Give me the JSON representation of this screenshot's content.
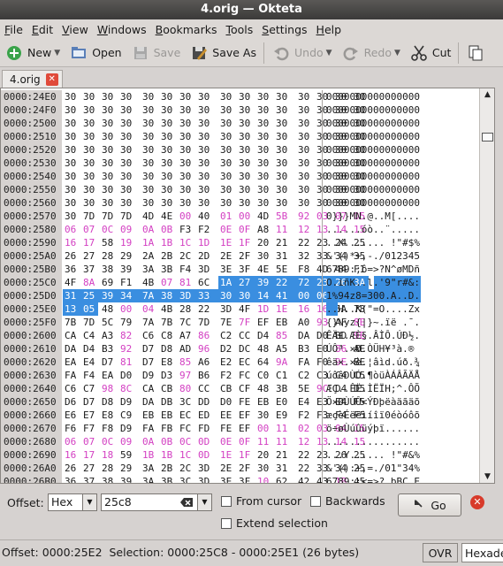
{
  "window": {
    "title": "4.orig — Okteta"
  },
  "menu": [
    {
      "label": "File",
      "key": "F",
      "rest": "ile"
    },
    {
      "label": "Edit",
      "key": "E",
      "rest": "dit"
    },
    {
      "label": "View",
      "key": "V",
      "rest": "iew"
    },
    {
      "label": "Windows",
      "key": "W",
      "rest": "indows"
    },
    {
      "label": "Bookmarks",
      "key": "B",
      "rest": "ookmarks"
    },
    {
      "label": "Tools",
      "key": "T",
      "rest": "ools"
    },
    {
      "label": "Settings",
      "key": "S",
      "rest": "ettings"
    },
    {
      "label": "Help",
      "key": "H",
      "rest": "elp"
    }
  ],
  "toolbar": {
    "new": "New",
    "open": "Open",
    "save": "Save",
    "save_as": "Save As",
    "undo": "Undo",
    "redo": "Redo",
    "cut": "Cut"
  },
  "tab": {
    "label": "4.orig"
  },
  "rows": [
    {
      "off": "0000:24E0",
      "hex": "30 30 30 30  30 30 30 30  30 30 30 30  30 30 30 30",
      "chars": "0000000000000000",
      "pink": [],
      "sel": []
    },
    {
      "off": "0000:24F0",
      "hex": "30 30 30 30  30 30 30 30  30 30 30 30  30 30 30 30",
      "chars": "0000000000000000",
      "pink": [],
      "sel": []
    },
    {
      "off": "0000:2500",
      "hex": "30 30 30 30  30 30 30 30  30 30 30 30  30 30 30 30",
      "chars": "0000000000000000",
      "pink": [],
      "sel": []
    },
    {
      "off": "0000:2510",
      "hex": "30 30 30 30  30 30 30 30  30 30 30 30  30 30 30 30",
      "chars": "0000000000000000",
      "pink": [],
      "sel": []
    },
    {
      "off": "0000:2520",
      "hex": "30 30 30 30  30 30 30 30  30 30 30 30  30 30 30 30",
      "chars": "0000000000000000",
      "pink": [],
      "sel": []
    },
    {
      "off": "0000:2530",
      "hex": "30 30 30 30  30 30 30 30  30 30 30 30  30 30 30 30",
      "chars": "0000000000000000",
      "pink": [],
      "sel": []
    },
    {
      "off": "0000:2540",
      "hex": "30 30 30 30  30 30 30 30  30 30 30 30  30 30 30 30",
      "chars": "0000000000000000",
      "pink": [],
      "sel": []
    },
    {
      "off": "0000:2550",
      "hex": "30 30 30 30  30 30 30 30  30 30 30 30  30 30 30 30",
      "chars": "0000000000000000",
      "pink": [],
      "sel": []
    },
    {
      "off": "0000:2560",
      "hex": "30 30 30 30  30 30 30 30  30 30 30 30  30 30 30 30",
      "chars": "0000000000000000",
      "pink": [],
      "sel": []
    },
    {
      "off": "0000:2570",
      "hex": "30 7D 7D 7D  4D 4E 00 40  01 00 4D 5B  92 03 07 05",
      "chars": "0}}}MN.@..M[....",
      "pink": [
        6,
        8,
        9,
        11,
        12,
        13,
        14,
        15
      ],
      "sel": []
    },
    {
      "off": "0000:2580",
      "hex": "06 07 0C 09  0A 0B F3 F2  0E 0F A8 11  12 13 14 15",
      "chars": "......óò..¨.....",
      "pink": [
        0,
        1,
        2,
        3,
        4,
        5,
        8,
        9,
        11,
        12,
        13,
        14,
        15
      ],
      "sel": []
    },
    {
      "off": "0000:2590",
      "hex": "16 17 58 19  1A 1B 1C 1D  1E 1F 20 21  22 23 24 25",
      "chars": "..X....... !\"#$%",
      "pink": [
        0,
        1,
        3,
        4,
        5,
        6,
        7,
        8,
        9
      ],
      "sel": []
    },
    {
      "off": "0000:25A0",
      "hex": "26 27 28 29  2A 2B 2C 2D  2E 2F 30 31  32 33 34 35",
      "chars": "&'()*+,-./012345",
      "pink": [],
      "sel": []
    },
    {
      "off": "0000:25B0",
      "hex": "36 37 38 39  3A 3B F4 3D  3E 3F 4E 5E  F8 4D 44 F1",
      "chars": "6789:;ô=>?N^øMDñ",
      "pink": [],
      "sel": []
    },
    {
      "off": "0000:25C0",
      "hex": "4F 8A 69 F1  4B 07 81 6C  1A 27 39 22  72 23 26 3A",
      "chars": "O.iñK..l.'9\"r#&:",
      "pink": [
        1,
        5,
        6,
        8
      ],
      "sel": [
        8,
        9,
        10,
        11,
        12,
        13,
        14,
        15
      ]
    },
    {
      "off": "0000:25D0",
      "hex": "31 25 39 34  7A 38 3D 33  30 30 14 41  00 06 44 17",
      "chars": "1%94z8=300.A..D.",
      "pink": [
        10,
        12,
        13,
        15
      ],
      "sel": [
        0,
        1,
        2,
        3,
        4,
        5,
        6,
        7,
        8,
        9,
        10,
        11,
        12,
        13,
        14,
        15
      ]
    },
    {
      "off": "0000:25E0",
      "hex": "13 05 48 00  04 4B 28 22  3D 4F 1D 1E  16 16 5A 78",
      "chars": "..H..K(\"=O....Zx",
      "pink": [
        0,
        1,
        3,
        4,
        10,
        11,
        12,
        13
      ],
      "sel": [
        0,
        1
      ]
    },
    {
      "off": "0000:25F0",
      "hex": "7B 7D 5C 79  7A 7B 7C 7D  7E 7F EF EB  A0 93 AF 8E",
      "chars": "{}\\yz{|}~.ïë .¯.",
      "pink": [
        9,
        13,
        15
      ],
      "sel": []
    },
    {
      "off": "0000:2600",
      "hex": "CA C4 A3 82  C6 C8 A7 86  C2 CC D4 85  DA D0 BD 9E",
      "chars": "ÊÄ£.ÆÈ§.ÂÌÔ.ÚÐ½.",
      "pink": [
        3,
        7,
        11,
        15
      ],
      "sel": []
    },
    {
      "off": "0000:2610",
      "hex": "DA D4 B3 92  D7 D8 AD 96  D2 DC 48 A5  B3 E0 86 AE",
      "chars": "ÚÔ³.×Ø.ÒÜH¥³à.®",
      "pink": [
        3,
        7,
        14
      ],
      "sel": []
    },
    {
      "off": "0000:2620",
      "hex": "EA E4 D7 81  D7 E8 85 A6  E2 EC 64 9A  FA F0 9E BE",
      "chars": "êä×.×è.¦âìd.úð.¾",
      "pink": [
        3,
        6,
        11,
        14
      ],
      "sel": []
    },
    {
      "off": "0000:2630",
      "hex": "FA F4 EA D0  D9 D3 97 B6  F2 FC C0 C1  C2 C3 C4 C5",
      "chars": "úôêÐÙÓ.¶òüÀÁÂÃÄÅ",
      "pink": [
        6
      ],
      "sel": []
    },
    {
      "off": "0000:2640",
      "hex": "C6 C7 98 8C  CA CB 80 CC  CB CF 48 3B  5E 9C D4 D5",
      "chars": "ÆÇ..ÊË.ÌËÏH;^.ÔÕ",
      "pink": [
        2,
        3,
        6,
        13
      ],
      "sel": []
    },
    {
      "off": "0000:2650",
      "hex": "D6 D7 D8 D9  DA DB 3C DD  D0 FE EB E0  E4 E3 E4 F5",
      "chars": "Ö×ØÙÚÛ<ÝÐþëàäãäõ",
      "pink": [],
      "sel": []
    },
    {
      "off": "0000:2660",
      "hex": "E6 E7 E8 C9  EB EB EC ED  EE EF 30 E9  F2 F3 F4 F5",
      "chars": "æçèÉëëìíîï0éòóôõ",
      "pink": [],
      "sel": []
    },
    {
      "off": "0000:2670",
      "hex": "F6 F7 F8 D9  FA FB FC FD  FE EF 00 11  02 03 04 15",
      "chars": "ö÷øÙúûüýþï......",
      "pink": [
        10,
        11,
        12,
        13,
        14,
        15
      ],
      "sel": []
    },
    {
      "off": "0000:2680",
      "hex": "06 07 0C 09  0A 0B 0C 0D  0E 0F 11 11  12 13 14 15",
      "chars": "................",
      "pink": [
        0,
        1,
        2,
        3,
        4,
        5,
        6,
        7,
        8,
        9,
        10,
        11,
        12,
        13,
        14,
        15
      ],
      "sel": []
    },
    {
      "off": "0000:2690",
      "hex": "16 17 18 59  1B 1B 1C 0D  1E 1F 20 21  22 23 26 25",
      "chars": "...Y...... !\"#&%",
      "pink": [
        0,
        1,
        2,
        4,
        5,
        6,
        7,
        8,
        9
      ],
      "sel": []
    },
    {
      "off": "0000:26A0",
      "hex": "26 27 28 29  3A 2B 2C 3D  2E 2F 30 31  22 33 34 25",
      "chars": "&'():+,=./01\"34%",
      "pink": [],
      "sel": []
    },
    {
      "off": "0000:26B0",
      "hex": "36 37 38 39  3A 3B 3C 3D  3E 3F 10 62  42 43 1B 45",
      "chars": "6789:;<=>?.bBC.E",
      "pink": [
        10,
        14
      ],
      "sel": []
    }
  ],
  "find": {
    "offset_label": "Offset:",
    "coding": "Hex",
    "value": "25c8",
    "from_cursor": "From cursor",
    "backwards": "Backwards",
    "extend_selection": "Extend selection",
    "go": "Go"
  },
  "status": {
    "text": "Offset: 0000:25E2  Selection: 0000:25C8 - 0000:25E1 (26 bytes)",
    "mode": "OVR",
    "value_coding": "Hexade"
  },
  "colors": {
    "selection": "#3a8ee0",
    "nonprintable": "#d33fc2",
    "offset_bg": "#d6d2d0"
  }
}
